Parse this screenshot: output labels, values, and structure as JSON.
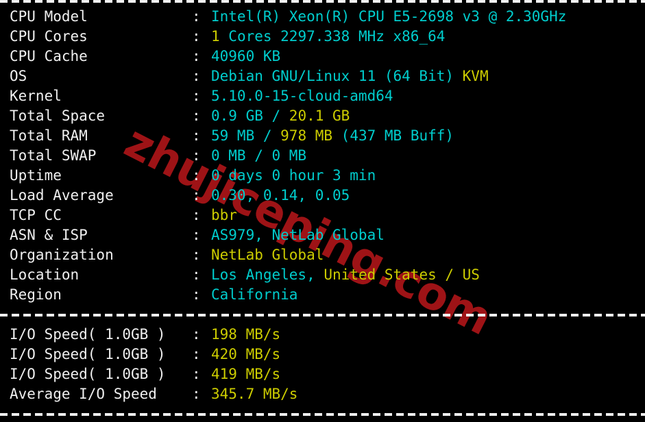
{
  "terminal": {
    "background_color": "#000000",
    "label_color": "#f0f0f0",
    "cyan_color": "#00cdcd",
    "yellow_color": "#cdcd00",
    "watermark_color": "#9e1316",
    "separator_char": "-",
    "colon": ":"
  },
  "watermark": {
    "text": "zhujiceping.com"
  },
  "system_info": {
    "rows": [
      {
        "label": "CPU Model",
        "parts": [
          {
            "text": "Intel(R) Xeon(R) CPU E5-2698 v3 @ 2.30GHz",
            "color": "cyan"
          }
        ]
      },
      {
        "label": "CPU Cores",
        "parts": [
          {
            "text": "1 ",
            "color": "yellow"
          },
          {
            "text": "Cores 2297.338 MHz x86_64",
            "color": "cyan"
          }
        ]
      },
      {
        "label": "CPU Cache",
        "parts": [
          {
            "text": "40960 KB",
            "color": "cyan"
          }
        ]
      },
      {
        "label": "OS",
        "parts": [
          {
            "text": "Debian GNU/Linux 11 (64 Bit) ",
            "color": "cyan"
          },
          {
            "text": "KVM",
            "color": "yellow"
          }
        ]
      },
      {
        "label": "Kernel",
        "parts": [
          {
            "text": "5.10.0-15-cloud-amd64",
            "color": "cyan"
          }
        ]
      },
      {
        "label": "Total Space",
        "parts": [
          {
            "text": "0.9 GB / ",
            "color": "cyan"
          },
          {
            "text": "20.1 GB",
            "color": "yellow"
          }
        ]
      },
      {
        "label": "Total RAM",
        "parts": [
          {
            "text": "59 MB / ",
            "color": "cyan"
          },
          {
            "text": "978 MB ",
            "color": "yellow"
          },
          {
            "text": "(437 MB Buff)",
            "color": "cyan"
          }
        ]
      },
      {
        "label": "Total SWAP",
        "parts": [
          {
            "text": "0 MB / 0 MB",
            "color": "cyan"
          }
        ]
      },
      {
        "label": "Uptime",
        "parts": [
          {
            "text": "0 days 0 hour 3 min",
            "color": "cyan"
          }
        ]
      },
      {
        "label": "Load Average",
        "parts": [
          {
            "text": "0.30, 0.14, 0.05",
            "color": "cyan"
          }
        ]
      },
      {
        "label": "TCP CC",
        "parts": [
          {
            "text": "bbr",
            "color": "yellow"
          }
        ]
      },
      {
        "label": "ASN & ISP",
        "parts": [
          {
            "text": "AS979, NetLab Global",
            "color": "cyan"
          }
        ]
      },
      {
        "label": "Organization",
        "parts": [
          {
            "text": "NetLab Global",
            "color": "yellow"
          }
        ]
      },
      {
        "label": "Location",
        "parts": [
          {
            "text": "Los Angeles, ",
            "color": "cyan"
          },
          {
            "text": "United States / US",
            "color": "yellow"
          }
        ]
      },
      {
        "label": "Region",
        "parts": [
          {
            "text": "California",
            "color": "cyan"
          }
        ]
      }
    ]
  },
  "io_speed": {
    "rows": [
      {
        "label": "I/O Speed( 1.0GB )",
        "parts": [
          {
            "text": "198 MB/s",
            "color": "yellow"
          }
        ]
      },
      {
        "label": "I/O Speed( 1.0GB )",
        "parts": [
          {
            "text": "420 MB/s",
            "color": "yellow"
          }
        ]
      },
      {
        "label": "I/O Speed( 1.0GB )",
        "parts": [
          {
            "text": "419 MB/s",
            "color": "yellow"
          }
        ]
      },
      {
        "label": "Average I/O Speed",
        "parts": [
          {
            "text": "345.7 MB/s",
            "color": "yellow"
          }
        ]
      }
    ]
  }
}
